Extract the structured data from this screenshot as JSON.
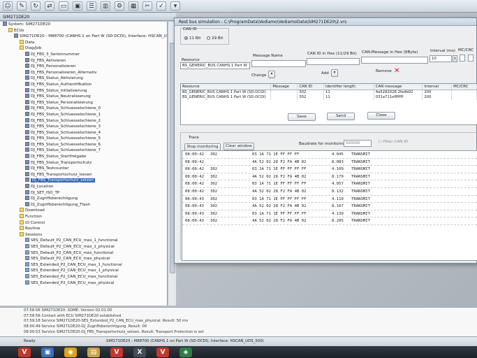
{
  "window": {
    "left_title": "SIM271DE20",
    "dialog_title": "Rest bus simulation - C:\\ProgramData\\Vediamo\\VediamoData\\SIM271DE20\\2.vrs"
  },
  "toolbar": {
    "icons": [
      "user-icon",
      "settings-icon",
      "refresh-icon",
      "connect-icon",
      "window-icon",
      "ecu-icon",
      "list-icon",
      "chart-icon",
      "gear-icon",
      "grid-icon",
      "tools-icon",
      "check-icon",
      "dropdown-icon"
    ]
  },
  "tree": {
    "items": [
      {
        "label": "System: SIM271DE20",
        "indent": 0,
        "kind": "root"
      },
      {
        "label": "ECUs",
        "indent": 1,
        "kind": "fold"
      },
      {
        "label": "SIM271DE20 - M88700 (CANHS 1 on Part W (SD-DCDI), Interface: HSCAN_UDS",
        "indent": 2,
        "kind": "ecu"
      },
      {
        "label": "Data",
        "indent": 3,
        "kind": "fold"
      },
      {
        "label": "Diag/Job",
        "indent": 3,
        "kind": "fold"
      },
      {
        "label": "DJ_FBS_3_Seriennummer",
        "indent": 4,
        "kind": "job"
      },
      {
        "label": "DJ_FBS_Aktivieren",
        "indent": 4,
        "kind": "job"
      },
      {
        "label": "DJ_FBS_Personalisieren",
        "indent": 4,
        "kind": "job"
      },
      {
        "label": "DJ_FBS_Personalisieren_Alternativ",
        "indent": 4,
        "kind": "job"
      },
      {
        "label": "DJ_FBS_Status_Aktivierung",
        "indent": 4,
        "kind": "job"
      },
      {
        "label": "DJ_FBS_Status_Authentifikation",
        "indent": 4,
        "kind": "job"
      },
      {
        "label": "DJ_FBS_Status_Initialisierung",
        "indent": 4,
        "kind": "job"
      },
      {
        "label": "DJ_FBS_Status_Neutralisierung",
        "indent": 4,
        "kind": "job"
      },
      {
        "label": "DJ_FBS_Status_Personalisierung",
        "indent": 4,
        "kind": "job"
      },
      {
        "label": "DJ_FBS_Status_Schluesselschiene_0",
        "indent": 4,
        "kind": "job"
      },
      {
        "label": "DJ_FBS_Status_Schluesselschiene_1",
        "indent": 4,
        "kind": "job"
      },
      {
        "label": "DJ_FBS_Status_Schluesselschiene_2",
        "indent": 4,
        "kind": "job"
      },
      {
        "label": "DJ_FBS_Status_Schluesselschiene_3",
        "indent": 4,
        "kind": "job"
      },
      {
        "label": "DJ_FBS_Status_Schluesselschiene_4",
        "indent": 4,
        "kind": "job"
      },
      {
        "label": "DJ_FBS_Status_Schluesselschiene_5",
        "indent": 4,
        "kind": "job"
      },
      {
        "label": "DJ_FBS_Status_Schluesselschiene_6",
        "indent": 4,
        "kind": "job"
      },
      {
        "label": "DJ_FBS_Status_Schluesselschiene_7",
        "indent": 4,
        "kind": "job"
      },
      {
        "label": "DJ_FBS_Status_Startfreigabe",
        "indent": 4,
        "kind": "job"
      },
      {
        "label": "DJ_FBS_Status_Transportschutz",
        "indent": 4,
        "kind": "job"
      },
      {
        "label": "DJ_FBS_Testcounter",
        "indent": 4,
        "kind": "job"
      },
      {
        "label": "DJ_FBS_Transportschutz_loesen",
        "indent": 4,
        "kind": "job"
      },
      {
        "label": "DJ_FBS_Transportschutz_setzen",
        "indent": 4,
        "kind": "job",
        "selected": true
      },
      {
        "label": "DJ_Location",
        "indent": 4,
        "kind": "job"
      },
      {
        "label": "DJ_SET_ISO_TP",
        "indent": 4,
        "kind": "job"
      },
      {
        "label": "DJ_Zugriffsberechtigung",
        "indent": 4,
        "kind": "job"
      },
      {
        "label": "DJ_Zugriffsberechtigung_Flash",
        "indent": 4,
        "kind": "job"
      },
      {
        "label": "Download",
        "indent": 3,
        "kind": "fold"
      },
      {
        "label": "Function",
        "indent": 3,
        "kind": "fold"
      },
      {
        "label": "IO Control",
        "indent": 3,
        "kind": "fold"
      },
      {
        "label": "Routine",
        "indent": 3,
        "kind": "fold"
      },
      {
        "label": "Sessions",
        "indent": 3,
        "kind": "fold"
      },
      {
        "label": "SES_Default_P2_CAN_ECU_max_1_functional",
        "indent": 4,
        "kind": "ses"
      },
      {
        "label": "SES_Default_P2_CAN_ECU_max_1_physical",
        "indent": 4,
        "kind": "ses"
      },
      {
        "label": "SES_Default_P2_CAN_ECU_max_functional",
        "indent": 4,
        "kind": "ses"
      },
      {
        "label": "SES_Default_P2_CAN_ECU_max_physical",
        "indent": 4,
        "kind": "ses"
      },
      {
        "label": "SES_Extended_P2_CAN_ECU_max_1_functional",
        "indent": 4,
        "kind": "ses"
      },
      {
        "label": "SES_Extended_P2_CAN_ECU_max_1_physical",
        "indent": 4,
        "kind": "ses"
      },
      {
        "label": "SES_Extended_P2_CAN_ECU_max_functional",
        "indent": 4,
        "kind": "ses"
      },
      {
        "label": "SES_Extended_P2_CAN_ECU_max_physical",
        "indent": 4,
        "kind": "ses"
      }
    ]
  },
  "log": [
    "07:58:56 SIM271DE20: SDME: Version 02.01.00",
    "07:58:56 Contact with ECU SIM271DE20 established.",
    "07:59:18 Service SIM271DE20-SES_Extended_P2_CAN_ECU_max_physical. Result: 50 ms",
    "08:00:49 Service SIM271DE20-DJ_Zugriffsberechtigung. Result: 00",
    "08:00:53 Service SIM271DE20-DJ_FBS_Transportschutz_setzen. Result: Transport Protection is set"
  ],
  "status": {
    "ready": "Ready",
    "connection": "SIM271DE20 - M88700 (CANHS 1 on Part W (SD-DCDI), Interface: HSCAN_UDS_500)"
  },
  "dialog": {
    "can_id_group": "CAN ID",
    "radio_11bit": "11 Bit",
    "radio_29bit": "29 Bit",
    "col_resource": "Resource",
    "col_message_name": "Message Name",
    "col_can_id_hex": "CAN ID in Hex (11/29 Bit)",
    "col_can_message": "CAN-Message in Hex (8Byte)",
    "col_interval": "Interval (ms)",
    "col_mc_crc": "MC/CRC",
    "resource_value": "BS_GENERIC_BUS CANHS 1 Part W",
    "message_name_value": "",
    "can_id_value": "",
    "can_message_value": "",
    "interval_value": "10",
    "change_label": "Change",
    "add_label": "Add",
    "remove_label": "Remove",
    "grid_headers": [
      "Resource",
      "Message",
      "CAN ID",
      "Identifier length",
      "CAN message",
      "Interval",
      "MC/CRC"
    ],
    "grid_rows": [
      [
        "BS_GENERIC_BUS CANHS 1 Part W (SD-DCDI)",
        "",
        "302",
        "11",
        "4a5282028 2fa4b02",
        "200",
        ""
      ],
      [
        "BS_GENERIC_BUS CANHS 1 Part W (SD-DCDI)",
        "",
        "302",
        "11",
        "031a711efffffff",
        "200",
        ""
      ]
    ],
    "save_label": "Save",
    "send_label": "Send",
    "close_label": "Close",
    "trace_label": "Trace",
    "stop_monitoring_label": "Stop monitoring",
    "clear_window_label": "Clear window",
    "baudrate_label": "Baudrate for monitoring",
    "baudrate_value": "500000",
    "filter_can_id_label": "Filter CAN ID"
  },
  "trace": [
    {
      "time": "08:00:42",
      "id": "302",
      "data": "03 1A 71 1E FF FF FF",
      "ts": "4.045",
      "dir": "TRANSMIT"
    },
    {
      "time": "08:00:42",
      "id": "",
      "data": "4A 52 02 28 F2 FA 4B 02",
      "ts": "8.083",
      "dir": "TRANSMIT"
    },
    {
      "time": "08:00:42",
      "id": "302",
      "data": "03 1A 71 1E FF FF FF FF",
      "ts": "4.109",
      "dir": "TRANSMIT"
    },
    {
      "time": "08:00:42",
      "id": "302",
      "data": "4A 52 02 28 F2 FA 4B 02",
      "ts": "8.179",
      "dir": "TRANSMIT"
    },
    {
      "time": "08:00:42",
      "id": "302",
      "data": "03 1A 71 1E FF FF FF FF",
      "ts": "4.057",
      "dir": "TRANSMIT"
    },
    {
      "time": "08:00:42",
      "id": "302",
      "data": "4A 52 02 28 F2 FA 4B 02",
      "ts": "8.132",
      "dir": "TRANSMIT"
    },
    {
      "time": "08:00:43",
      "id": "302",
      "data": "03 1A 71 1E FF FF FF FF",
      "ts": "4.110",
      "dir": "TRANSMIT"
    },
    {
      "time": "08:00:43",
      "id": "302",
      "data": "4A 52 02 28 F2 FA 4B 02",
      "ts": "8.167",
      "dir": "TRANSMIT"
    },
    {
      "time": "08:00:43",
      "id": "302",
      "data": "03 1A 71 1E FF FF FF FF",
      "ts": "4.139",
      "dir": "TRANSMIT"
    },
    {
      "time": "08:00:43",
      "id": "302",
      "data": "4A 52 02 28 F2 FA 4B 02",
      "ts": "8.205",
      "dir": "TRANSMIT"
    }
  ],
  "taskbar": {
    "apps": [
      {
        "name": "vediamo-icon",
        "glyph": "V",
        "color": "#c0392b"
      },
      {
        "name": "explorer-icon",
        "glyph": "▣",
        "color": "#3b6fb6"
      },
      {
        "name": "chrome-icon",
        "glyph": "◉",
        "color": "#d9a21f"
      },
      {
        "name": "folder-icon",
        "glyph": "▤",
        "color": "#caa34a"
      },
      {
        "name": "vediamo2-icon",
        "glyph": "V",
        "color": "#c0392b"
      },
      {
        "name": "xentry-icon",
        "glyph": "X",
        "color": "#444c55"
      },
      {
        "name": "vediamo3-icon",
        "glyph": "V",
        "color": "#c0392b"
      },
      {
        "name": "app-icon",
        "glyph": "◈",
        "color": "#2d7d46"
      }
    ]
  }
}
